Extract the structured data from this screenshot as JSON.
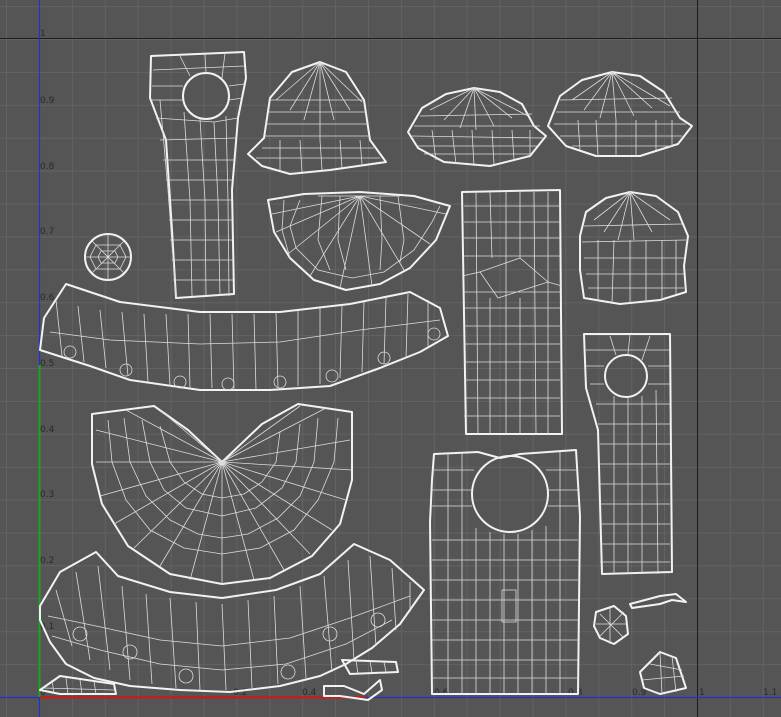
{
  "editor": {
    "title": "UV Texture Editor",
    "background_color": "#555555",
    "grid_color": "#636363",
    "border_color": "#1c1c1c",
    "u_axis_color": "#c41e1e",
    "v_axis_color": "#1fa31f",
    "blue_line_color": "#2233cc",
    "wire_color": "#f2f2f2"
  },
  "ruler": {
    "v_ticks": [
      {
        "id": "v1",
        "label": "1"
      },
      {
        "id": "v09",
        "label": "0.9"
      },
      {
        "id": "v08",
        "label": "0.8"
      },
      {
        "id": "v07",
        "label": "0.7"
      },
      {
        "id": "v06",
        "label": "0.6"
      },
      {
        "id": "v05",
        "label": "0.5"
      },
      {
        "id": "v04",
        "label": "0.4"
      },
      {
        "id": "v03",
        "label": "0.3"
      },
      {
        "id": "v02",
        "label": "0.2"
      },
      {
        "id": "v01",
        "label": "0.1"
      }
    ],
    "u_ticks": [
      {
        "id": "u0",
        "label": "0"
      },
      {
        "id": "u02",
        "label": "0.2"
      },
      {
        "id": "u04",
        "label": "0.4"
      },
      {
        "id": "u06",
        "label": "0.6"
      },
      {
        "id": "u08",
        "label": "0.8"
      },
      {
        "id": "u09",
        "label": "0.9"
      },
      {
        "id": "u1",
        "label": "1"
      },
      {
        "id": "u11",
        "label": "1.1"
      }
    ]
  },
  "uv_shells": [
    "sleeve-left",
    "hat-brim-cap",
    "hat-cap-center",
    "hat-cap-right",
    "hat-crown-fan",
    "button-disc",
    "waistband-strip",
    "torso-strip",
    "hood",
    "sleeve-right",
    "skirt-fan",
    "skirt-ruffle",
    "bodice-front",
    "small-bits"
  ]
}
